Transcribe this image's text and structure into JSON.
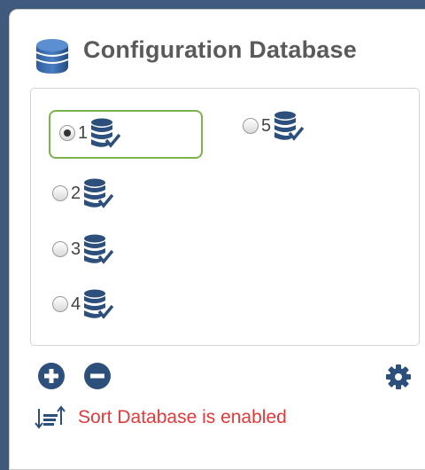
{
  "panel": {
    "title": "Configuration Database",
    "title_icon": "database-icon"
  },
  "databases": [
    {
      "number": "1",
      "selected": true,
      "icon": "database-check-icon"
    },
    {
      "number": "2",
      "selected": false,
      "icon": "database-check-icon"
    },
    {
      "number": "3",
      "selected": false,
      "icon": "database-check-icon"
    },
    {
      "number": "4",
      "selected": false,
      "icon": "database-check-icon"
    },
    {
      "number": "5",
      "selected": false,
      "icon": "database-check-icon"
    }
  ],
  "footer": {
    "add_icon": "plus-circle-icon",
    "remove_icon": "minus-circle-icon",
    "settings_icon": "gear-icon",
    "sort_icon": "sort-icon",
    "sort_status": "Sort Database is enabled"
  },
  "colors": {
    "background": "#3f5a7c",
    "accent_blue": "#2c4f7c",
    "selected_border": "#7cb24b",
    "sort_text": "#e23a3a",
    "title_text": "#5a5a5a"
  }
}
